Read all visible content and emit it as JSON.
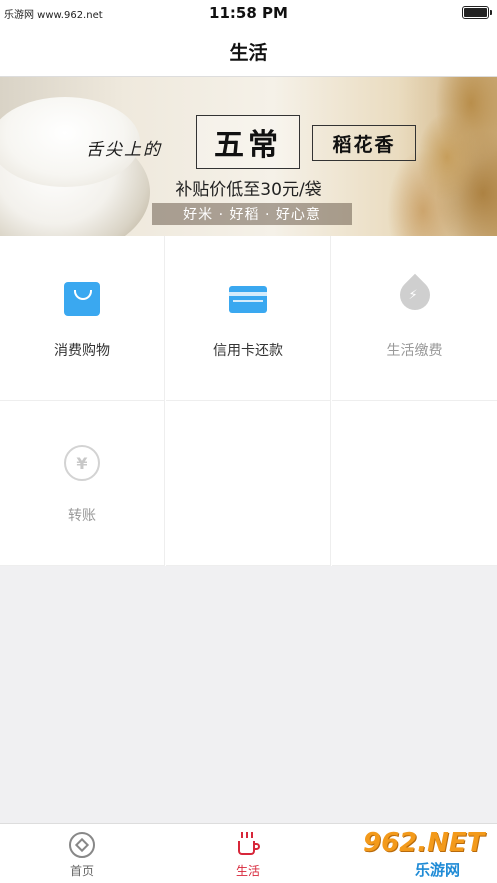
{
  "status_bar": {
    "left_text": "乐游网 www.962.net",
    "time": "11:58 PM"
  },
  "nav": {
    "title": "生活"
  },
  "banner": {
    "slogan": "舌尖上的",
    "brand": "五常",
    "product": "稻花香",
    "offer": "补贴价低至30元/袋",
    "tagline": "好米 · 好稻 · 好心意"
  },
  "grid": {
    "items": [
      {
        "label": "消费购物",
        "icon": "shopping-bag-icon",
        "enabled": true
      },
      {
        "label": "信用卡还款",
        "icon": "credit-card-icon",
        "enabled": true
      },
      {
        "label": "生活缴费",
        "icon": "utility-drop-icon",
        "enabled": false
      },
      {
        "label": "转账",
        "icon": "yen-transfer-icon",
        "enabled": false
      }
    ]
  },
  "tab_bar": {
    "tabs": [
      {
        "label": "首页",
        "icon": "home-icon",
        "active": false
      },
      {
        "label": "生活",
        "icon": "coffee-cup-icon",
        "active": true
      }
    ]
  },
  "watermark": {
    "main": "962.NET",
    "sub": "乐游网"
  },
  "colors": {
    "accent": "#d7273a",
    "icon_blue": "#3aa8f0",
    "disabled_icon": "#cfcfcf",
    "background": "#f0f0f2"
  }
}
